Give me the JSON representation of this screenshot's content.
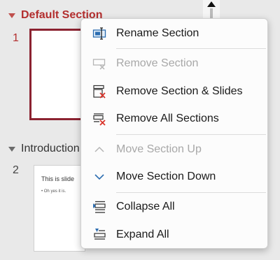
{
  "sections": [
    {
      "title": "Default Section",
      "slide_number": "1"
    },
    {
      "title": "Introduction",
      "slide_number": "2"
    }
  ],
  "slide2": {
    "title": "This is slide",
    "bullet": "• Oh yes it is."
  },
  "menu": {
    "items": [
      {
        "label": "Rename Section",
        "icon": "rename-section-icon",
        "enabled": true
      },
      {
        "label": "Remove Section",
        "icon": "remove-section-icon",
        "enabled": false
      },
      {
        "label": "Remove Section & Slides",
        "icon": "remove-section-slides-icon",
        "enabled": true
      },
      {
        "label": "Remove All Sections",
        "icon": "remove-all-sections-icon",
        "enabled": true
      },
      {
        "label": "Move Section Up",
        "icon": "move-up-icon",
        "enabled": false
      },
      {
        "label": "Move Section Down",
        "icon": "move-down-icon",
        "enabled": true
      },
      {
        "label": "Collapse All",
        "icon": "collapse-all-icon",
        "enabled": true
      },
      {
        "label": "Expand All",
        "icon": "expand-all-icon",
        "enabled": true
      }
    ]
  },
  "colors": {
    "accent": "#c0504d",
    "selected_border": "#8b2230",
    "icon_blue": "#2b6cb0",
    "delete_red": "#d9342b"
  }
}
